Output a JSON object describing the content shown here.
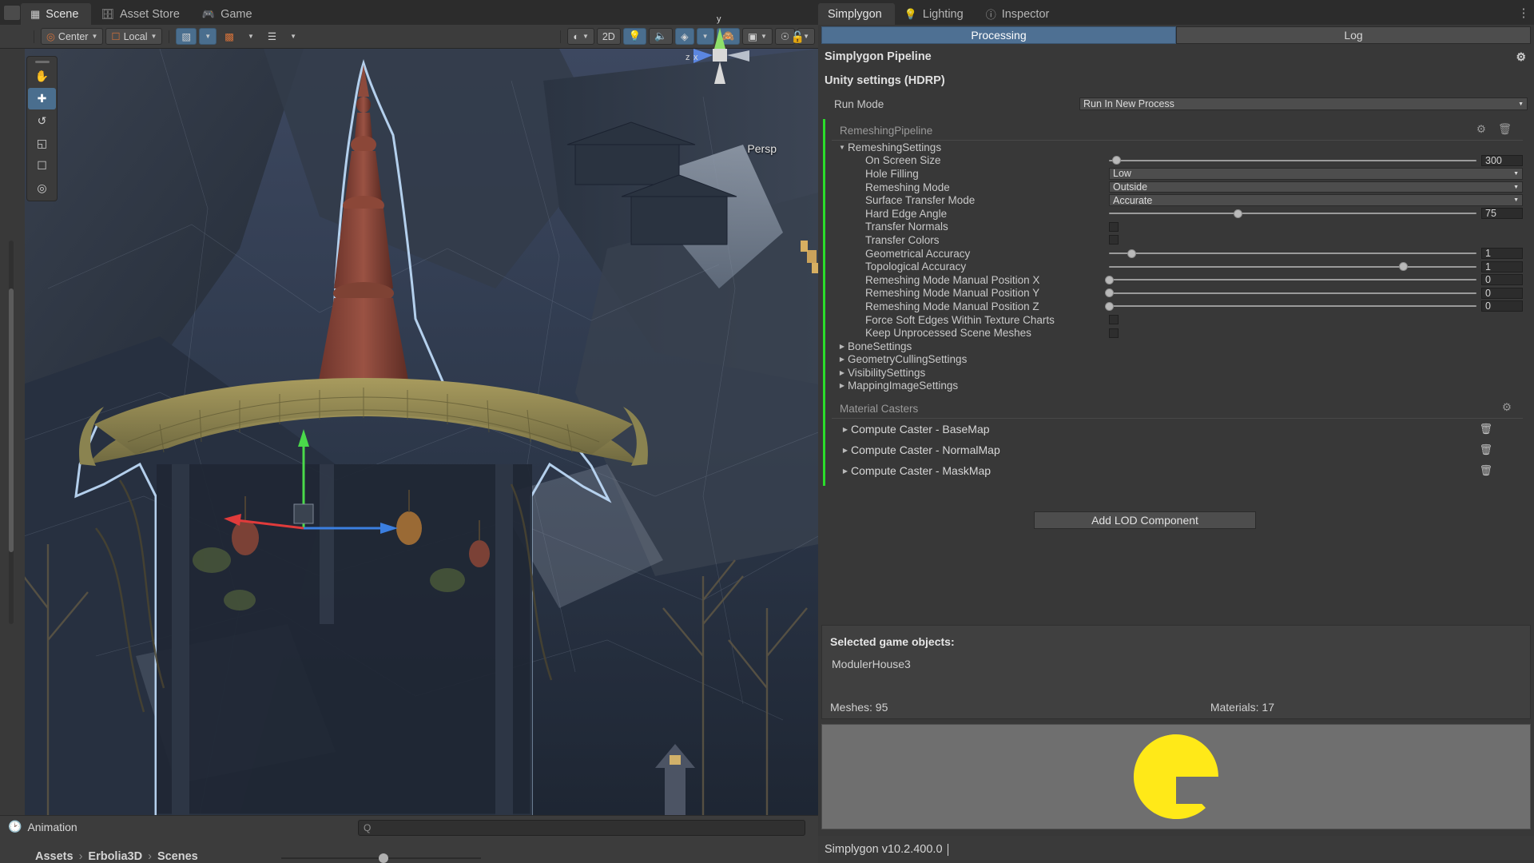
{
  "scene": {
    "tabs": [
      {
        "label": "Scene",
        "icon": "grid-icon",
        "active": true
      },
      {
        "label": "Asset Store",
        "icon": "store-icon",
        "active": false
      },
      {
        "label": "Game",
        "icon": "gamepad-icon",
        "active": false
      }
    ],
    "toolbar": {
      "pivot_mode": "Center",
      "pivot_rotation": "Local",
      "twod_label": "2D",
      "grid_snap_icon": "grid-snap-icon",
      "magnet_icon": "magnet-icon",
      "ruler_icon": "ruler-icon",
      "shading_icon": "shading-mode-icon",
      "light_icon": "lighting-toggle-icon",
      "audio_icon": "audio-mute-icon",
      "fx_icon": "effects-icon",
      "hidden_icon": "scene-visibility-icon",
      "camera_icon": "scene-camera-icon",
      "gizmos_icon": "gizmos-icon"
    },
    "tools": [
      "hand-tool",
      "move-tool",
      "rotate-tool",
      "scale-tool",
      "rect-tool",
      "transform-tool"
    ],
    "gizmo": {
      "x": "x",
      "y": "y",
      "z": "z",
      "projection": "Persp"
    },
    "animation_label": "Animation",
    "breadcrumb": [
      "Assets",
      "Erbolia3D",
      "Scenes"
    ],
    "search_placeholder": "Q"
  },
  "simplygon": {
    "tabs": [
      {
        "label": "Simplygon",
        "icon": "",
        "active": true
      },
      {
        "label": "Lighting",
        "icon": "bulb-icon",
        "active": false
      },
      {
        "label": "Inspector",
        "icon": "info-icon",
        "active": false
      }
    ],
    "modes": [
      {
        "label": "Processing",
        "active": true
      },
      {
        "label": "Log",
        "active": false
      }
    ],
    "pipeline_title": "Simplygon Pipeline",
    "unity_settings_title": "Unity settings (HDRP)",
    "run_mode": {
      "label": "Run Mode",
      "value": "Run In New Process"
    },
    "pipeline_name": "RemeshingPipeline",
    "settings_group": "RemeshingSettings",
    "settings": [
      {
        "label": "On Screen Size",
        "type": "slider",
        "value": "300",
        "pos": 2
      },
      {
        "label": "Hole Filling",
        "type": "dropdown",
        "value": "Low"
      },
      {
        "label": "Remeshing Mode",
        "type": "dropdown",
        "value": "Outside"
      },
      {
        "label": "Surface Transfer Mode",
        "type": "dropdown",
        "value": "Accurate"
      },
      {
        "label": "Hard Edge Angle",
        "type": "slider",
        "value": "75",
        "pos": 35
      },
      {
        "label": "Transfer Normals",
        "type": "checkbox",
        "value": ""
      },
      {
        "label": "Transfer Colors",
        "type": "checkbox",
        "value": ""
      },
      {
        "label": "Geometrical Accuracy",
        "type": "slider",
        "value": "1",
        "pos": 6
      },
      {
        "label": "Topological Accuracy",
        "type": "slider",
        "value": "1",
        "pos": 80
      },
      {
        "label": "Remeshing Mode Manual Position X",
        "type": "slider",
        "value": "0",
        "pos": 0
      },
      {
        "label": "Remeshing Mode Manual Position Y",
        "type": "slider",
        "value": "0",
        "pos": 0
      },
      {
        "label": "Remeshing Mode Manual Position Z",
        "type": "slider",
        "value": "0",
        "pos": 0
      },
      {
        "label": "Force Soft Edges Within Texture Charts",
        "type": "checkbox",
        "value": ""
      },
      {
        "label": "Keep Unprocessed Scene Meshes",
        "type": "checkbox",
        "value": ""
      }
    ],
    "collapsed_groups": [
      "BoneSettings",
      "GeometryCullingSettings",
      "VisibilitySettings",
      "MappingImageSettings"
    ],
    "material_casters_title": "Material Casters",
    "material_casters": [
      "Compute Caster - BaseMap",
      "Compute Caster - NormalMap",
      "Compute Caster - MaskMap"
    ],
    "add_lod_label": "Add LOD Component",
    "selected_title": "Selected game objects:",
    "selected_objects": [
      "ModulerHouse3"
    ],
    "meshes_label": "Meshes: 95",
    "materials_label": "Materials: 17",
    "version": "Simplygon v10.2.400.0",
    "accent_green": "#2bdd2b",
    "accent_blue": "#4e7093",
    "logo_yellow": "#ffe918"
  }
}
